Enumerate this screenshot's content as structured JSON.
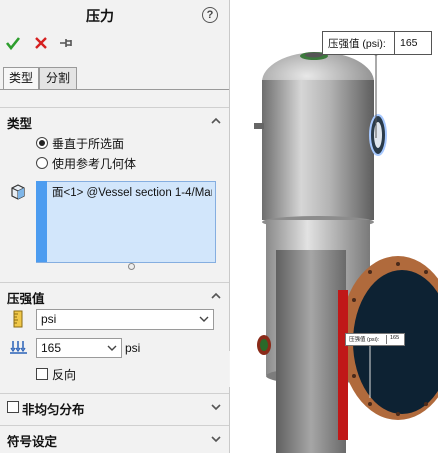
{
  "panel": {
    "title": "压力",
    "help_icon": "?",
    "toolbar": {
      "ok_icon": "check-icon",
      "cancel_icon": "close-icon",
      "pin_icon": "pushpin-icon"
    },
    "tabs": [
      {
        "label": "类型"
      },
      {
        "label": "分割"
      }
    ],
    "type_section": {
      "header": "类型",
      "options": [
        {
          "label": "垂直于所选面",
          "selected": true
        },
        {
          "label": "使用参考几何体",
          "selected": false
        }
      ],
      "selection_items": [
        "面<1> @Vessel section 1-4/Mar"
      ]
    },
    "pressure_section": {
      "header": "压强值",
      "unit_value": "psi",
      "value": "165",
      "value_unit": "psi",
      "reverse_label": "反向"
    },
    "nonuniform_section": {
      "header": "非均匀分布"
    },
    "symbol_section": {
      "header": "符号设定"
    }
  },
  "viewport": {
    "callout_label": "压强值 (psi):",
    "callout_value": "165",
    "mini_callout_label": "压强值 (psi):",
    "mini_callout_value": "165"
  },
  "colors": {
    "accent_blue": "#4c9cf0",
    "selection_fill": "#d2e6fb",
    "ok_green": "#2e9e2e",
    "cancel_red": "#d62020",
    "flange_copper": "#b06a3c",
    "flange_face": "#0d2233"
  }
}
